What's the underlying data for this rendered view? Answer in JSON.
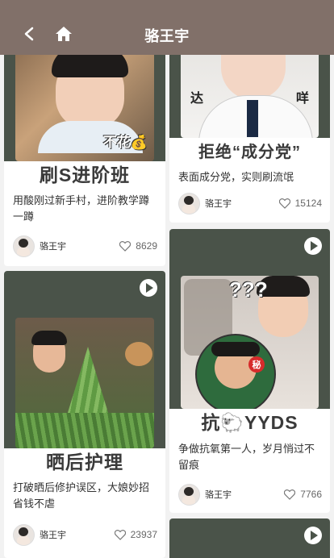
{
  "header": {
    "title": "骆王宇"
  },
  "cards": [
    {
      "caption": "刷S进阶班",
      "desc": "用酸刚过新手村，进阶教学蹲一蹲",
      "author": "骆王宇",
      "likes": "8629",
      "sticker": "不花💰"
    },
    {
      "caption": "拒绝“成分党”",
      "desc": "表面成分党，实则刷流氓",
      "author": "骆王宇",
      "likes": "15124",
      "sticker_left": "达",
      "sticker_right": "咩"
    },
    {
      "caption": "晒后护理",
      "desc": "打破晒后修护误区，大娘妙招省钱不虐",
      "author": "骆王宇",
      "likes": "23937"
    },
    {
      "caption": "抗🐑YYDS",
      "desc": "争做抗氧第一人，岁月悄过不留痕",
      "author": "骆王宇",
      "likes": "7766",
      "sticker": "???",
      "badge": "秘"
    },
    {
      "caption": "",
      "desc": "",
      "author": "",
      "likes": ""
    }
  ],
  "colors": {
    "header": "#817069",
    "cover": "#4a5349"
  }
}
